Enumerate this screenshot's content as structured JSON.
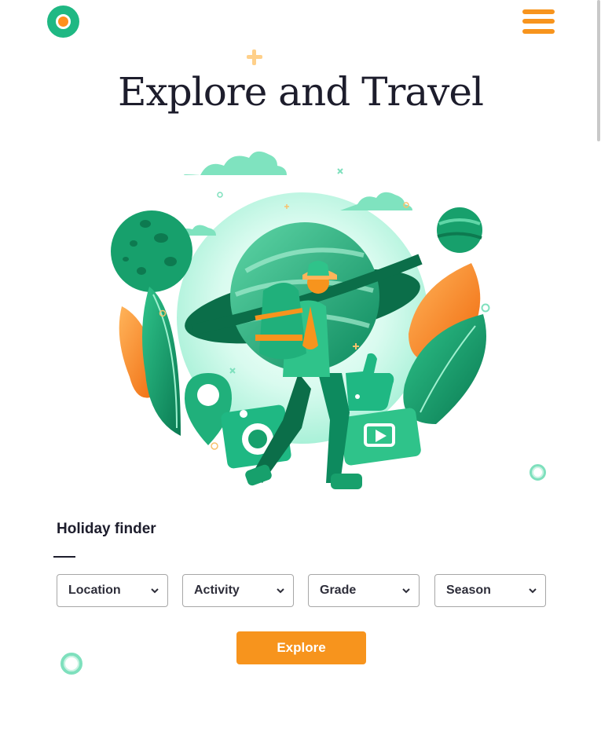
{
  "header": {
    "logo_icon": "circle-logo-icon",
    "menu_icon": "hamburger-menu-icon"
  },
  "hero": {
    "title": "Explore and Travel",
    "illustration": "hiker-with-backpack-and-planet-illustration"
  },
  "finder": {
    "title": "Holiday finder",
    "selects": [
      {
        "value": "Location"
      },
      {
        "value": "Activity"
      },
      {
        "value": "Grade"
      },
      {
        "value": "Season"
      }
    ],
    "explore_label": "Explore"
  },
  "colors": {
    "accent": "#f7941d",
    "brand_green": "#1fb883",
    "text": "#1d1d2c"
  }
}
